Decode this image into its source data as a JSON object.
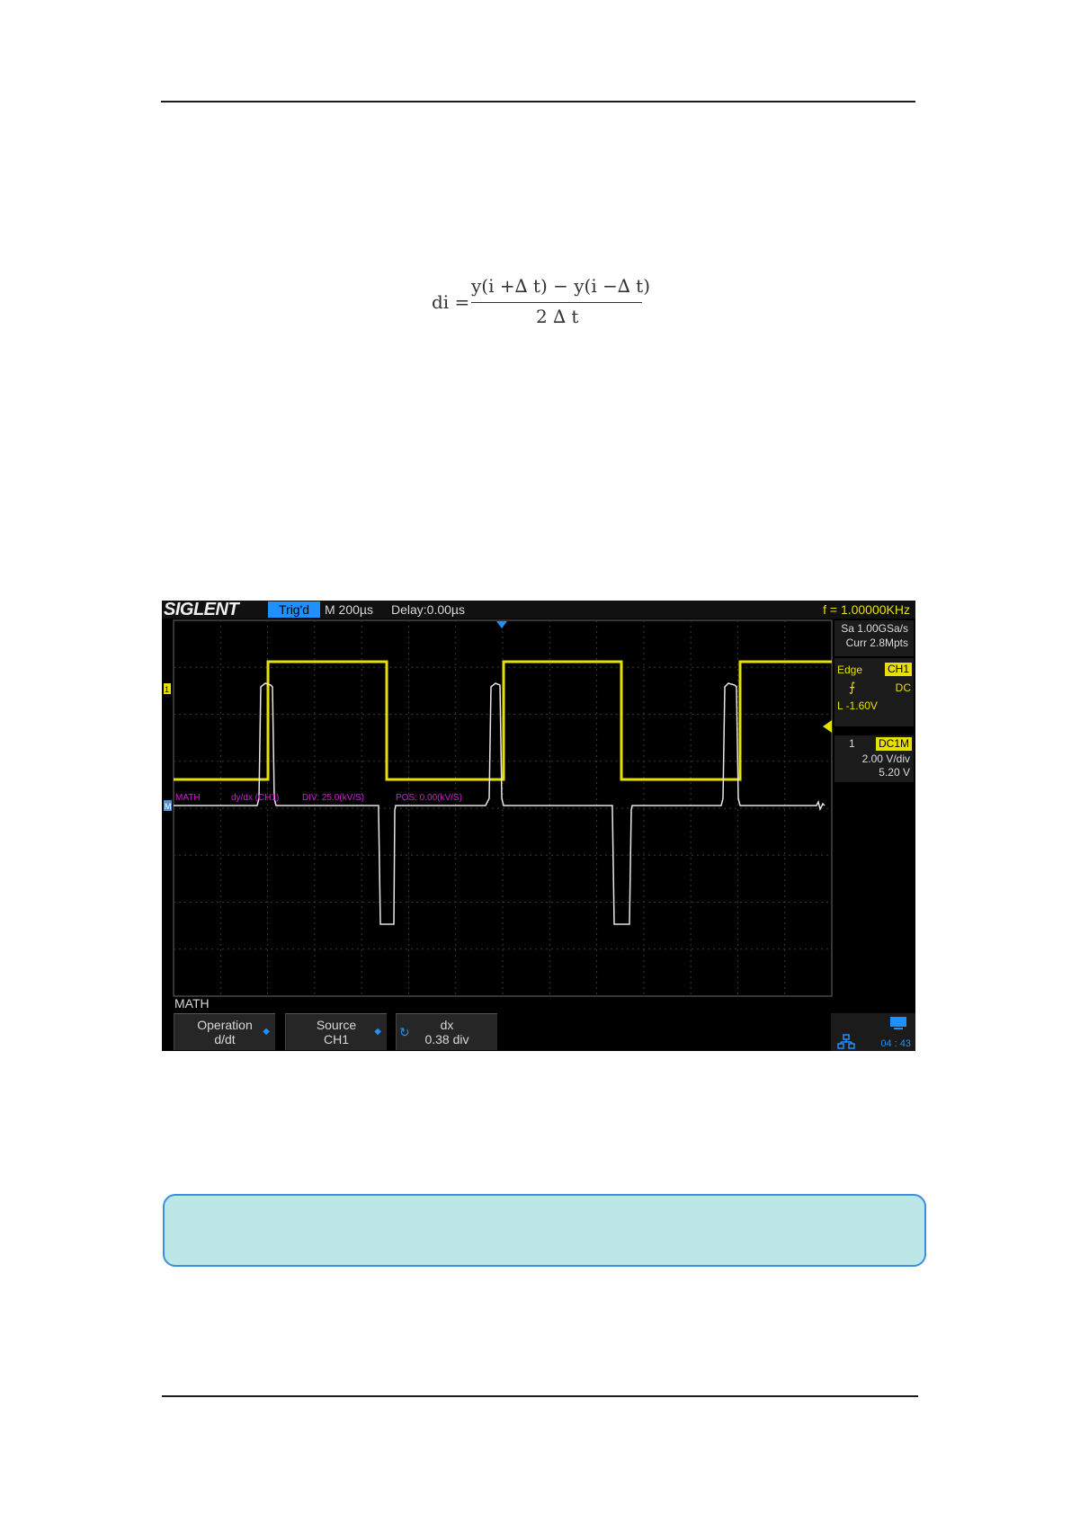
{
  "formula": {
    "lhs": "di =",
    "numerator": "y(i +∆ t) − y(i −∆ t)",
    "denominator": "2 ∆ t"
  },
  "scope": {
    "logo": "SIGLENT",
    "trigger_status": "Trig'd",
    "timebase": "M 200µs",
    "delay": "Delay:0.00µs",
    "frequency": "f = 1.00000KHz",
    "sample_rate": "Sa 1.00GSa/s",
    "memory_depth": "Curr 2.8Mpts",
    "trigger": {
      "type": "Edge",
      "source": "CH1",
      "coupling": "DC",
      "level": "L -1.60V"
    },
    "channel": {
      "number": "1",
      "impedance": "DC1M",
      "scale": "2.00 V/div",
      "offset": "5.20 V"
    },
    "math_trace": {
      "label": "MATH",
      "function": "dy/dx (CH1)",
      "div": "DIV: 25.0(kV/S)",
      "pos": "POS: 0.00(kV/S)"
    },
    "menu_title": "MATH",
    "softkeys": [
      {
        "line1": "Operation",
        "line2": "d/dt"
      },
      {
        "line1": "Source",
        "line2": "CH1"
      },
      {
        "line1": "dx",
        "line2": "0.38 div"
      }
    ],
    "clock": "04 : 43",
    "colors": {
      "ch1": "#e8e000",
      "math": "#e6e6e6",
      "math_label": "#d61fd6",
      "accent": "#1e90ff"
    }
  }
}
